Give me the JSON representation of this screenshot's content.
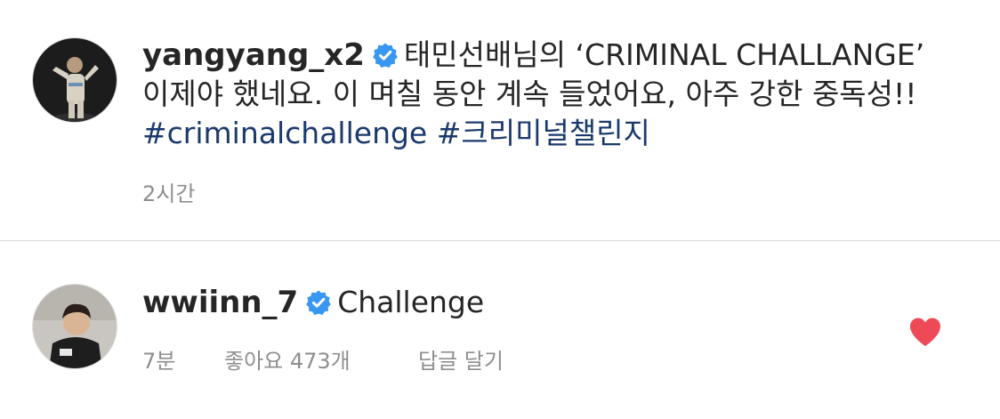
{
  "post": {
    "username": "yangyang_x2",
    "caption_line1": "태민선배님의 ‘CRIMINAL CHALLANGE’",
    "caption_line2": "이제야 했네요. 이 며칠 동안 계속 들었어요, 아주 강한 중독성!!",
    "hashtags": [
      "#criminalchallenge",
      "#크리미널챌린지"
    ],
    "time": "2시간",
    "avatar_icon": "user-photo-icon",
    "verified_icon": "verified-badge-icon"
  },
  "comment": {
    "username": "wwiinn_7",
    "text": "Challenge",
    "time": "7분",
    "likes": "좋아요 473개",
    "reply": "답글 달기",
    "like_icon": "heart-icon",
    "like_color": "#ed4956"
  },
  "colors": {
    "text": "#262626",
    "secondary": "#8e8e8e",
    "hashtag": "#1b3a6b",
    "verified": "#3897f0",
    "divider": "#dbdbdb"
  }
}
